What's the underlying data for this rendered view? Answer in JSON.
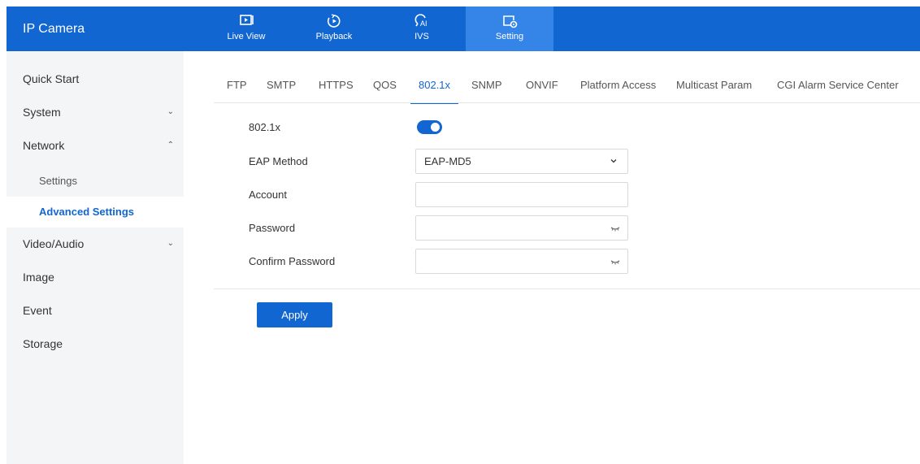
{
  "app": {
    "title": "IP Camera"
  },
  "nav": {
    "tabs": [
      {
        "label": "Live View",
        "icon": "live-view-icon"
      },
      {
        "label": "Playback",
        "icon": "playback-icon"
      },
      {
        "label": "IVS",
        "icon": "ivs-ai-icon"
      },
      {
        "label": "Setting",
        "icon": "setting-icon",
        "active": true
      }
    ]
  },
  "sidebar": {
    "items": [
      {
        "label": "Quick Start"
      },
      {
        "label": "System",
        "chevron": "down"
      },
      {
        "label": "Network",
        "chevron": "up"
      },
      {
        "label": "Settings"
      },
      {
        "label": "Advanced Settings",
        "active": true
      },
      {
        "label": "Video/Audio",
        "chevron": "down"
      },
      {
        "label": "Image"
      },
      {
        "label": "Event"
      },
      {
        "label": "Storage"
      }
    ]
  },
  "content": {
    "tabs": [
      {
        "label": "FTP"
      },
      {
        "label": "SMTP"
      },
      {
        "label": "HTTPS"
      },
      {
        "label": "QOS"
      },
      {
        "label": "802.1x",
        "active": true
      },
      {
        "label": "SNMP"
      },
      {
        "label": "ONVIF"
      },
      {
        "label": "Platform Access"
      },
      {
        "label": "Multicast Param"
      },
      {
        "label": "CGI Alarm Service Center"
      }
    ],
    "form": {
      "enable_label": "802.1x",
      "enable_on": true,
      "eap_label": "EAP Method",
      "eap_value": "EAP-MD5",
      "account_label": "Account",
      "account_value": "",
      "password_label": "Password",
      "password_value": "",
      "confirm_label": "Confirm Password",
      "confirm_value": ""
    },
    "apply_label": "Apply"
  },
  "colors": {
    "primary": "#1166d2",
    "active_tab_bg": "#3584e8",
    "sidebar_bg": "#f4f5f7"
  }
}
